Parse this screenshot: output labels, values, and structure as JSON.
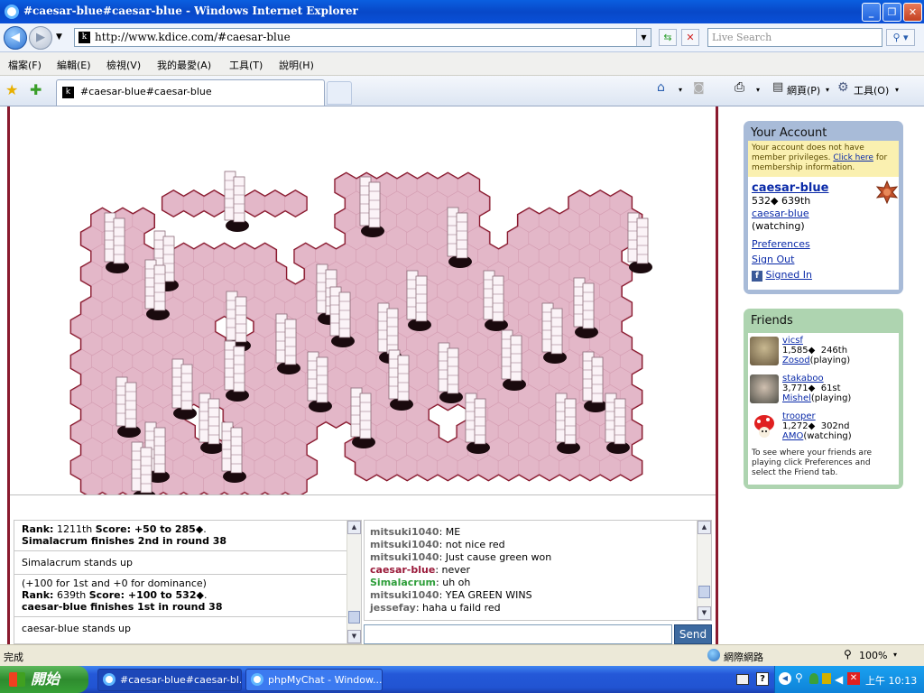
{
  "window": {
    "title": "#caesar-blue#caesar-blue - Windows Internet Explorer"
  },
  "address": {
    "url": "http://www.kdice.com/#caesar-blue",
    "search_placeholder": "Live Search"
  },
  "menu": [
    "檔案(F)",
    "編輯(E)",
    "檢視(V)",
    "我的最愛(A)",
    "工具(T)",
    "說明(H)"
  ],
  "tab": {
    "label": "#caesar-blue#caesar-blue"
  },
  "toolbar": {
    "page_label": "網頁(P)",
    "tools_label": "工具(O)"
  },
  "colors": {
    "board_fill": "#e3b7c8",
    "board_edge": "#8a1a2e"
  },
  "log": [
    {
      "rank_label": "Rank:",
      "rank": " 1211th ",
      "score_label": "Score:",
      "score": " +50 to 285",
      "finish": "Simalacrum finishes 2nd in round 38"
    },
    {
      "text": "Simalacrum stands up"
    },
    {
      "bonus": "(+100 for 1st and +0 for dominance)",
      "rank_label": "Rank:",
      "rank": " 639th ",
      "score_label": "Score:",
      "score": " +100 to 532",
      "finish": "caesar-blue finishes 1st in round 38"
    },
    {
      "text": "caesar-blue stands up"
    }
  ],
  "chat": [
    {
      "name": "mitsuki1040",
      "color": "#666666",
      "msg": "ME"
    },
    {
      "name": "mitsuki1040",
      "color": "#666666",
      "msg": "not nice red"
    },
    {
      "name": "mitsuki1040",
      "color": "#666666",
      "msg": "Just cause green won"
    },
    {
      "name": "caesar-blue",
      "color": "#9a1a3a",
      "msg": "never"
    },
    {
      "name": "Simalacrum",
      "color": "#2e9e3a",
      "msg": "uh oh"
    },
    {
      "name": "mitsuki1040",
      "color": "#666666",
      "msg": "YEA GREEN WINS"
    },
    {
      "name": "jessefay",
      "color": "#666666",
      "msg": "haha u faild red"
    }
  ],
  "chat_send": "Send",
  "account": {
    "title": "Your Account",
    "warning_pre": "Your account does not have member privileges.",
    "warning_link": "Click here",
    "warning_post": "for membership information.",
    "username": "caesar-blue",
    "points": "532",
    "rank": "639th",
    "sub_name": "caesar-blue",
    "status": "(watching)",
    "preferences": "Preferences",
    "sign_out": "Sign Out",
    "signed_in": "Signed In"
  },
  "friends": {
    "title": "Friends",
    "list": [
      {
        "name": "vicsf",
        "points": "1,585",
        "rank": "246th",
        "player": "Zosod",
        "status": "(playing)"
      },
      {
        "name": "stakaboo",
        "points": "3,771",
        "rank": "61st",
        "player": "Mishel",
        "status": "(playing)"
      },
      {
        "name": "trooper",
        "points": "1,272",
        "rank": "302nd",
        "player": "AMO",
        "status": "(watching)"
      }
    ],
    "note": "To see where your friends are playing click Preferences and select the Friend tab."
  },
  "status": {
    "left": "完成",
    "zone": "網際網路",
    "zoom": "100%"
  },
  "taskbar": {
    "start": "開始",
    "tasks": [
      "#caesar-blue#caesar-bl...",
      "phpMyChat - Window..."
    ],
    "clock": "上午 10:13"
  }
}
